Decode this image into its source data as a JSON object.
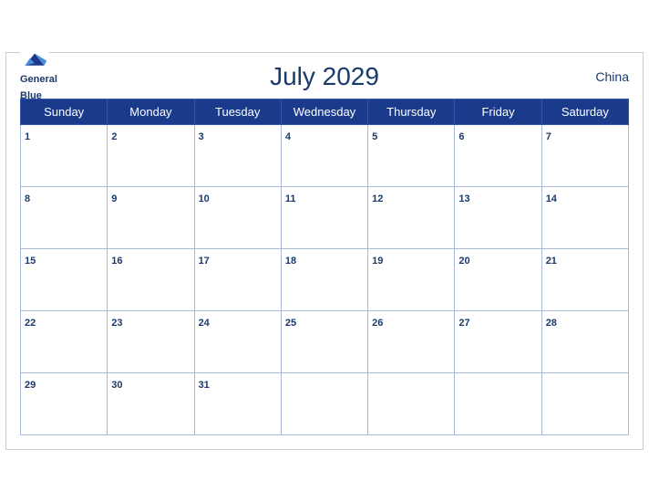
{
  "header": {
    "title": "July 2029",
    "country": "China",
    "logo_line1": "General",
    "logo_line2": "Blue"
  },
  "weekdays": [
    "Sunday",
    "Monday",
    "Tuesday",
    "Wednesday",
    "Thursday",
    "Friday",
    "Saturday"
  ],
  "weeks": [
    [
      {
        "day": 1,
        "active": true
      },
      {
        "day": 2,
        "active": true
      },
      {
        "day": 3,
        "active": true
      },
      {
        "day": 4,
        "active": true
      },
      {
        "day": 5,
        "active": true
      },
      {
        "day": 6,
        "active": true
      },
      {
        "day": 7,
        "active": true
      }
    ],
    [
      {
        "day": 8,
        "active": true
      },
      {
        "day": 9,
        "active": true
      },
      {
        "day": 10,
        "active": true
      },
      {
        "day": 11,
        "active": true
      },
      {
        "day": 12,
        "active": true
      },
      {
        "day": 13,
        "active": true
      },
      {
        "day": 14,
        "active": true
      }
    ],
    [
      {
        "day": 15,
        "active": true
      },
      {
        "day": 16,
        "active": true
      },
      {
        "day": 17,
        "active": true
      },
      {
        "day": 18,
        "active": true
      },
      {
        "day": 19,
        "active": true
      },
      {
        "day": 20,
        "active": true
      },
      {
        "day": 21,
        "active": true
      }
    ],
    [
      {
        "day": 22,
        "active": true
      },
      {
        "day": 23,
        "active": true
      },
      {
        "day": 24,
        "active": true
      },
      {
        "day": 25,
        "active": true
      },
      {
        "day": 26,
        "active": true
      },
      {
        "day": 27,
        "active": true
      },
      {
        "day": 28,
        "active": true
      }
    ],
    [
      {
        "day": 29,
        "active": true
      },
      {
        "day": 30,
        "active": true
      },
      {
        "day": 31,
        "active": true
      },
      {
        "day": null,
        "active": false
      },
      {
        "day": null,
        "active": false
      },
      {
        "day": null,
        "active": false
      },
      {
        "day": null,
        "active": false
      }
    ]
  ]
}
